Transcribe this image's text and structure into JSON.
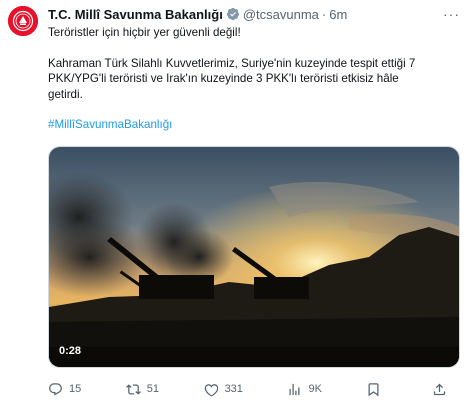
{
  "tweet": {
    "author_name": "T.C. Millî Savunma Bakanlığı",
    "handle": "@tcsavunma",
    "separator": "·",
    "time": "6m",
    "more_label": "···",
    "line1": "Teröristler için hiçbir yer güvenli değil!",
    "line2a": "Kahraman Türk Silahlı Kuvvetlerimiz, Suriye'nin kuzeyinde tespit ettiği 7",
    "line2b": "PKK/YPG'li teröristi ve Irak'ın kuzeyinde 3 PKK'lı teröristi etkisiz hâle",
    "line2c": "getirdi.",
    "hashtag": "#MillîSavunmaBakanlığı",
    "video_duration": "0:28"
  },
  "actions": {
    "replies": "15",
    "retweets": "51",
    "likes": "331",
    "views": "9K"
  },
  "colors": {
    "link": "#1d9bf0",
    "verified_badge": "#829aab",
    "avatar_bg": "#e8102a",
    "muted_text": "#536471"
  },
  "icons": [
    "reply-icon",
    "retweet-icon",
    "like-icon",
    "views-icon",
    "bookmark-icon",
    "share-icon",
    "verified-badge-icon"
  ]
}
